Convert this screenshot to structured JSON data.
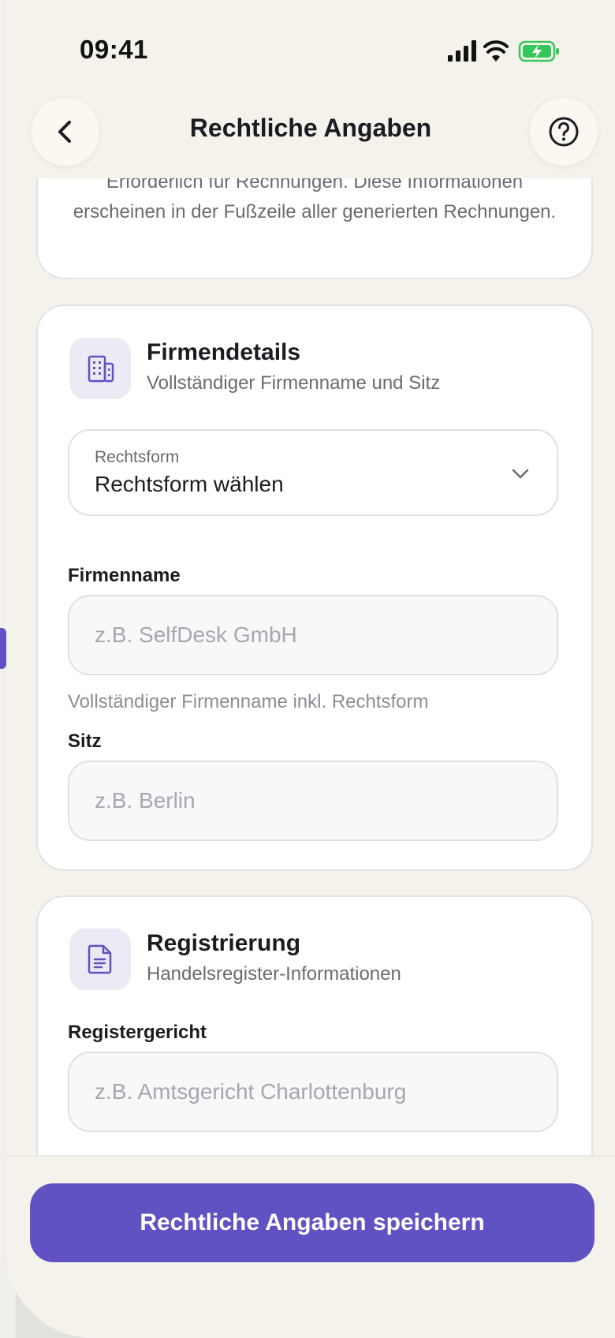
{
  "status_bar": {
    "time": "09:41"
  },
  "header": {
    "title": "Rechtliche Angaben"
  },
  "info_card": {
    "text": "Erforderlich für Rechnungen. Diese Informationen erscheinen in der Fußzeile aller generierten Rechnungen."
  },
  "company_section": {
    "title": "Firmendetails",
    "subtitle": "Vollständiger Firmenname und Sitz",
    "icon": "building-icon",
    "legal_form": {
      "label": "Rechtsform",
      "value": "Rechtsform wählen"
    },
    "company_name": {
      "label": "Firmenname",
      "placeholder": "z.B. SelfDesk GmbH",
      "help": "Vollständiger Firmenname inkl. Rechtsform"
    },
    "seat": {
      "label": "Sitz",
      "placeholder": "z.B. Berlin"
    }
  },
  "registration_section": {
    "title": "Registrierung",
    "subtitle": "Handelsregister-Informationen",
    "icon": "document-icon",
    "register_court": {
      "label": "Registergericht",
      "placeholder": "z.B. Amtsgericht Charlottenburg"
    }
  },
  "footer": {
    "save_label": "Rechtliche Angaben speichern"
  },
  "colors": {
    "accent": "#6152c4",
    "background": "#f5f2ec"
  }
}
